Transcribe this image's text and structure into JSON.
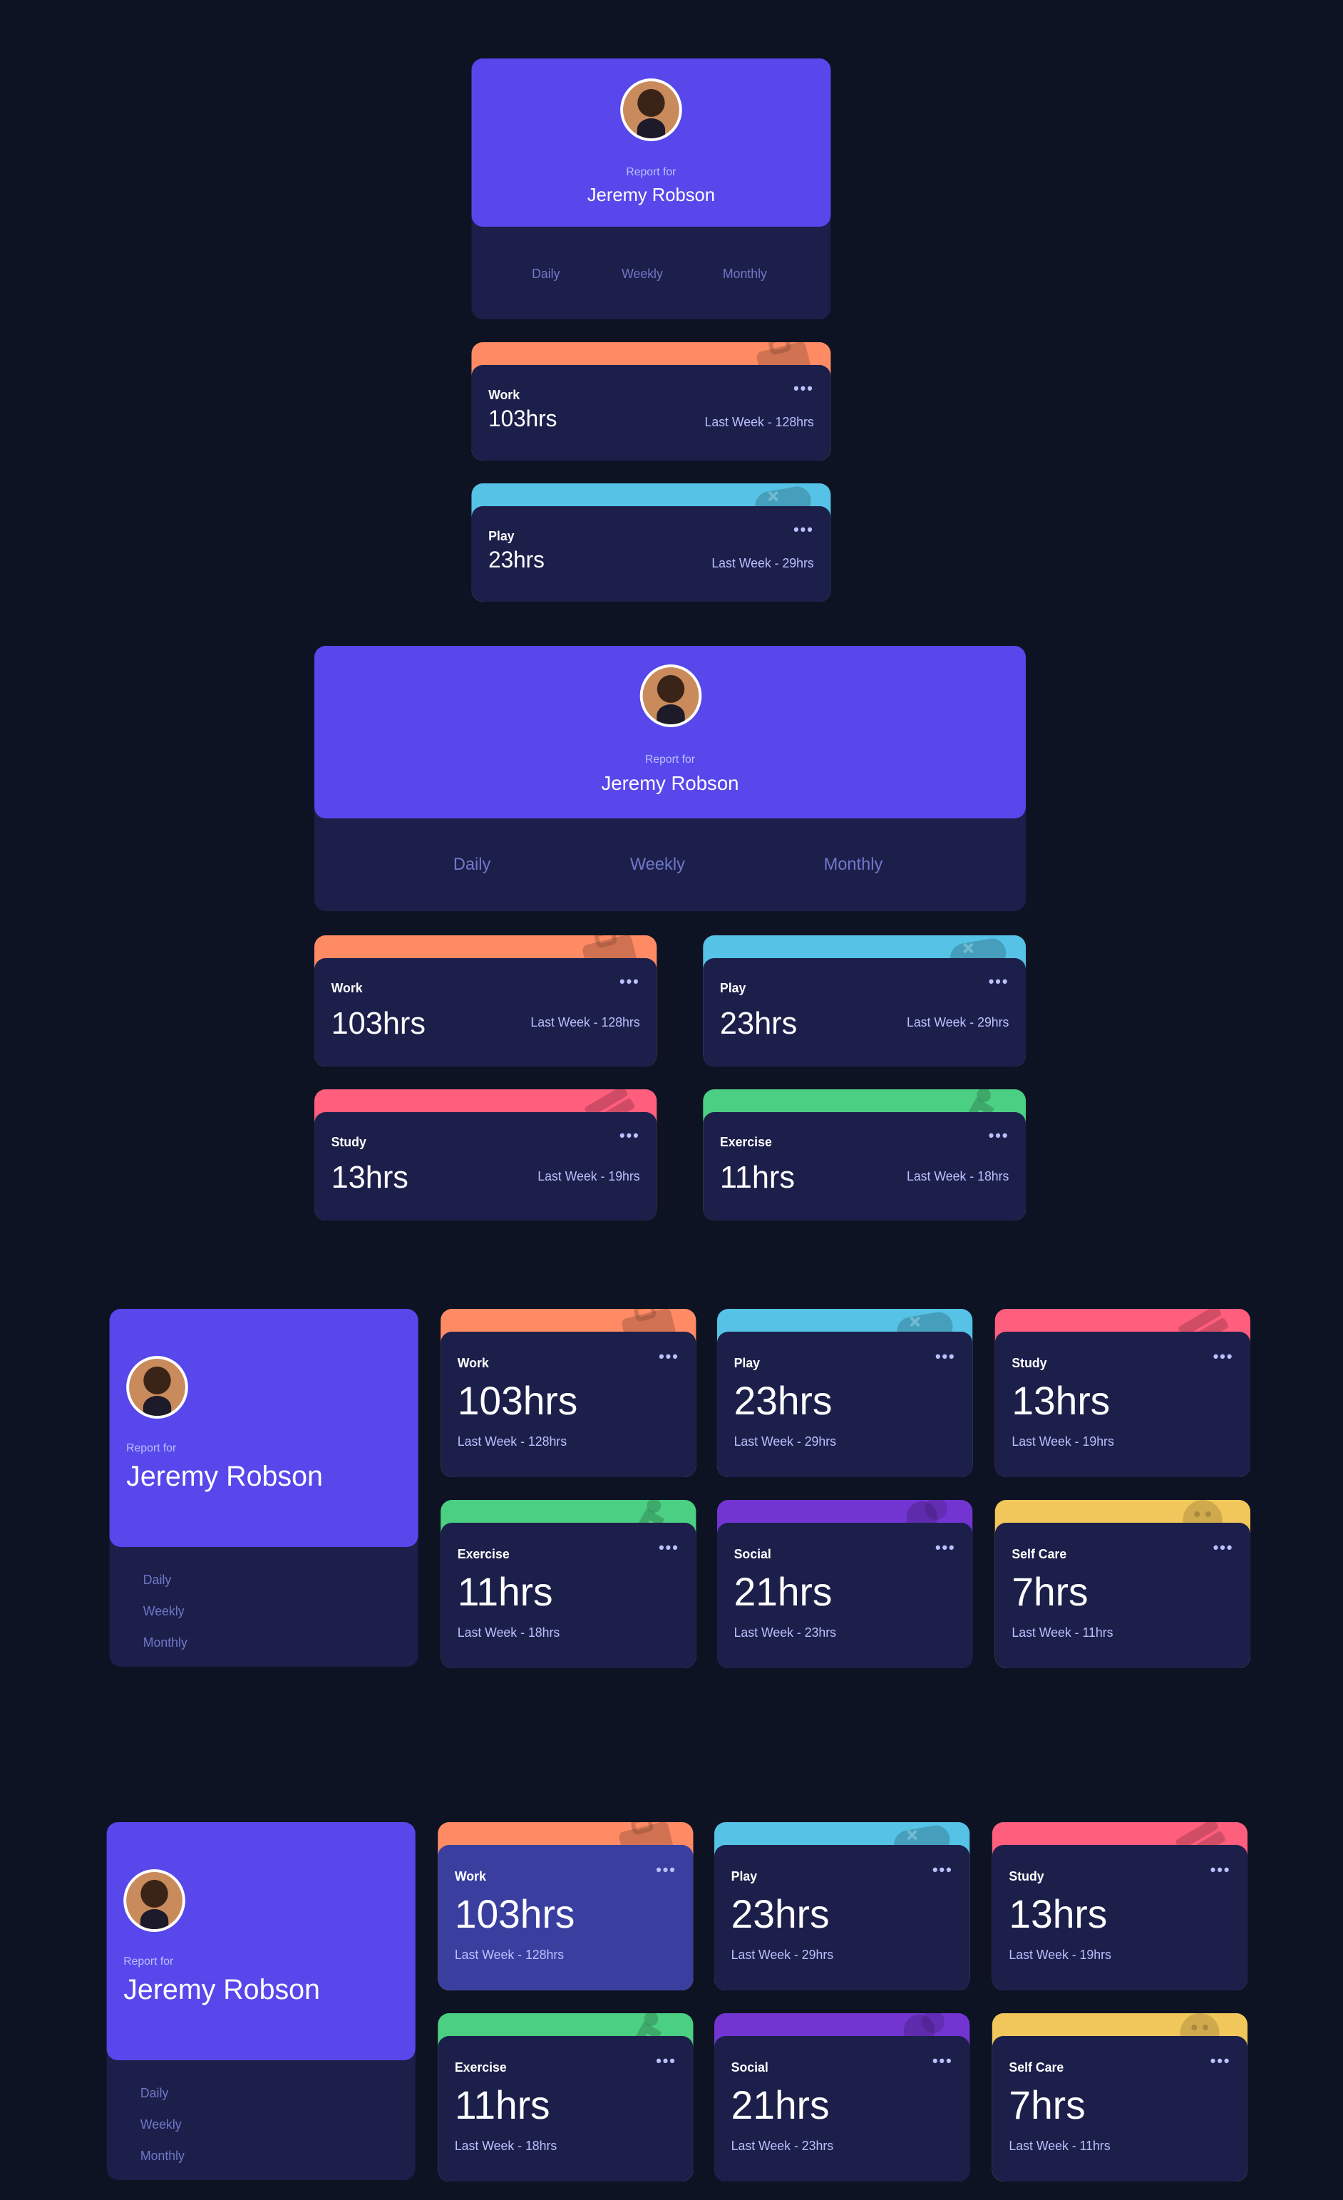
{
  "profile": {
    "report_for": "Report for",
    "name": "Jeremy Robson",
    "avatar_icon": "user-avatar-photo"
  },
  "periods": {
    "daily": "Daily",
    "weekly": "Weekly",
    "monthly": "Monthly"
  },
  "activities": [
    {
      "title": "Work",
      "current": "103hrs",
      "previous": "Last Week - 128hrs",
      "color": "#ff8b64",
      "icon": "briefcase-icon"
    },
    {
      "title": "Play",
      "current": "23hrs",
      "previous": "Last Week - 29hrs",
      "color": "#55c2e6",
      "icon": "gamepad-icon"
    },
    {
      "title": "Study",
      "current": "13hrs",
      "previous": "Last Week - 19hrs",
      "color": "#ff5e7d",
      "icon": "book-icon"
    },
    {
      "title": "Exercise",
      "current": "11hrs",
      "previous": "Last Week - 18hrs",
      "color": "#4bcf82",
      "icon": "running-icon"
    },
    {
      "title": "Social",
      "current": "21hrs",
      "previous": "Last Week - 23hrs",
      "color": "#7335d2",
      "icon": "chat-icon"
    },
    {
      "title": "Self Care",
      "current": "7hrs",
      "previous": "Last Week - 11hrs",
      "color": "#f1c75b",
      "icon": "heart-icon"
    }
  ],
  "menu_icon": "ellipsis-icon",
  "colors": {
    "background": "#0d1323",
    "card": "#1c1f4a",
    "profile": "#5847eb",
    "hover": "#3a3f9f",
    "muted": "#bbc0ff"
  }
}
